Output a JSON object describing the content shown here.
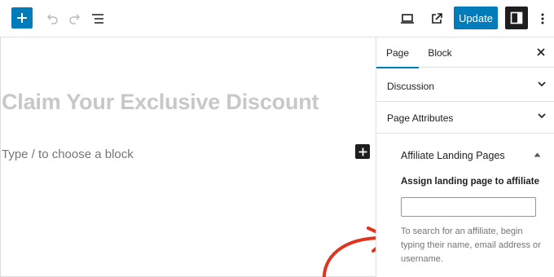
{
  "toolbar": {
    "update_label": "Update",
    "icons": {
      "inserter": "plus-icon",
      "undo": "undo-icon",
      "redo": "redo-icon",
      "list_view": "list-view-icon",
      "preview": "desktop-preview-icon",
      "view_page": "external-link-icon",
      "settings": "sidebar-toggle-icon",
      "options": "more-vertical-icon"
    }
  },
  "editor": {
    "title": "Claim Your Exclusive Discount",
    "block_placeholder": "Type / to choose a block"
  },
  "sidebar": {
    "tabs": [
      {
        "label": "Page",
        "active": true
      },
      {
        "label": "Block",
        "active": false
      }
    ],
    "panels": [
      {
        "title": "Discussion",
        "expanded": false
      },
      {
        "title": "Page Attributes",
        "expanded": false
      }
    ],
    "affiliate": {
      "title": "Affiliate Landing Pages",
      "expanded": true,
      "field_label": "Assign landing page to affiliate",
      "field_value": "",
      "help_text": "To search for an affiliate, begin typing their name, email address or username."
    }
  },
  "colors": {
    "accent": "#007cba",
    "dark": "#1e1e1e",
    "arrow": "#e0341e"
  }
}
